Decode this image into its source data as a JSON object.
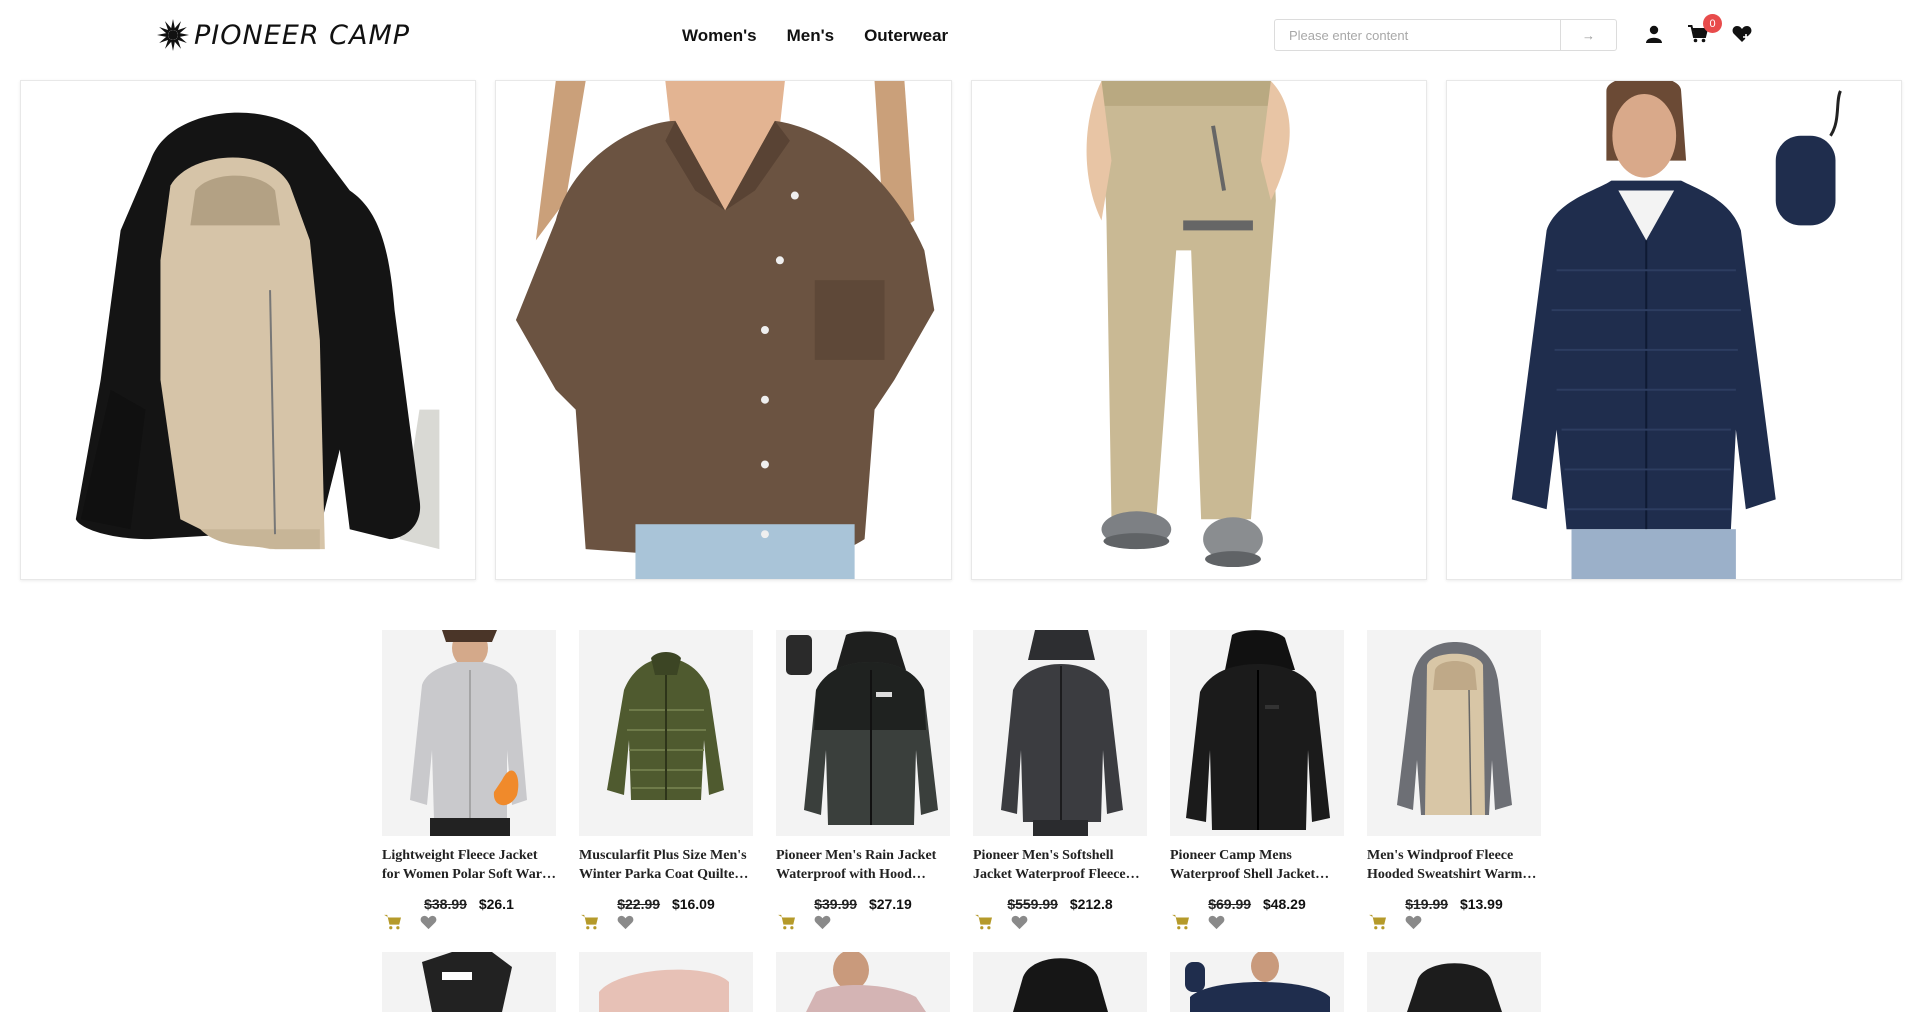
{
  "header": {
    "logo_text": "PIONEER CAMP",
    "nav": [
      "Women's",
      "Men's",
      "Outerwear"
    ],
    "search": {
      "placeholder": "Please enter content",
      "value": "",
      "button_glyph": "→"
    },
    "icons": [
      "user-icon",
      "cart-icon",
      "heart-icon"
    ],
    "cart_count": "0"
  },
  "colors": {
    "cart_icon": "#b59a2a",
    "heart_icon": "#8a8a8a",
    "badge": "#e84b4b"
  },
  "banner": [
    {
      "name": "fleece-hoodie-black",
      "colors": [
        "#1a1a1a",
        "#d6c4a8"
      ]
    },
    {
      "name": "brown-button-shirt",
      "colors": [
        "#6b5341",
        "#a9c4d8"
      ]
    },
    {
      "name": "khaki-hiking-pants",
      "colors": [
        "#c9b994",
        "#7d8084"
      ]
    },
    {
      "name": "navy-puffer-jacket",
      "colors": [
        "#1f2d4d",
        "#9bb0c9"
      ]
    }
  ],
  "products": [
    {
      "title": "Lightweight Fleece Jacket for Women Polar Soft Warm Zip Up",
      "old_price": "$38.99",
      "price": "$26.1",
      "color": "#c9c9cc"
    },
    {
      "title": "Muscularfit Plus Size Men's Winter Parka Coat Quilted Puffer",
      "old_price": "$22.99",
      "price": "$16.09",
      "color": "#4f5a2f"
    },
    {
      "title": "Pioneer Men's Rain Jacket Waterproof with Hood Lightweight",
      "old_price": "$39.99",
      "price": "$27.19",
      "color": "#3a3f3c"
    },
    {
      "title": "Pioneer Men's Softshell Jacket Waterproof Fleece Lined",
      "old_price": "$559.99",
      "price": "$212.8",
      "color": "#3b3c40"
    },
    {
      "title": "Pioneer Camp Mens Waterproof Shell Jacket Hooded",
      "old_price": "$69.99",
      "price": "$48.29",
      "color": "#1b1b1b"
    },
    {
      "title": "Men's Windproof Fleece Hooded Sweatshirt Warm Sherpa Lined",
      "old_price": "$19.99",
      "price": "$13.99",
      "color": "#6d6f75"
    }
  ],
  "products_row2": [
    {
      "color": "#222222"
    },
    {
      "color": "#e7c1b6"
    },
    {
      "color": "#d4b4b4"
    },
    {
      "color": "#161616"
    },
    {
      "color": "#1f2d4d"
    },
    {
      "color": "#1c1c1c"
    }
  ]
}
